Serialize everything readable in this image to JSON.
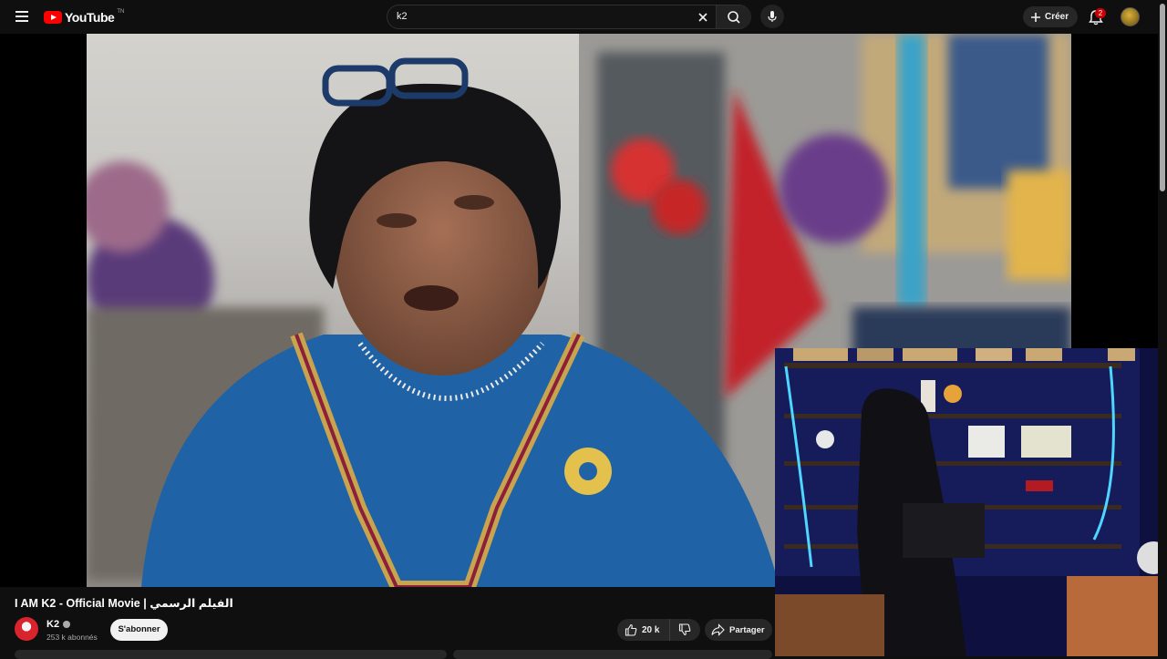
{
  "header": {
    "logo_text": "YouTube",
    "logo_tm": "TN",
    "search_value": "k2",
    "create_label": "Créer",
    "notification_count": "2"
  },
  "video": {
    "title": "I AM K2 - Official Movie | الفيلم الرسمي",
    "channel_name": "K2",
    "subscribers": "253 k abonnés",
    "subscribe_label": "S'abonner",
    "like_count": "20 k",
    "share_label": "Partager"
  },
  "icons": {
    "menu": "menu-icon",
    "search": "search-icon",
    "clear": "close-icon",
    "mic": "mic-icon",
    "create": "plus-icon",
    "bell": "bell-icon",
    "like": "thumbs-up-icon",
    "dislike": "thumbs-down-icon",
    "share": "share-icon",
    "verified": "verified-icon"
  },
  "colors": {
    "background": "#0f0f0f",
    "brand_red": "#ff0000",
    "badge_red": "#cc0000",
    "button_bg": "#272727"
  }
}
